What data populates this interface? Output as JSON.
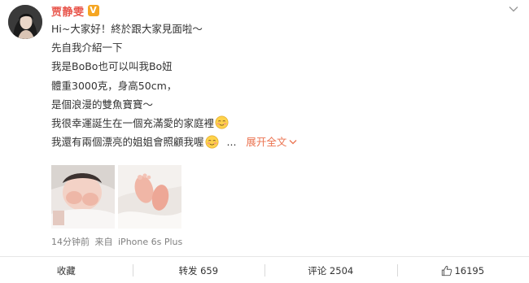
{
  "user": {
    "name": "贾静雯",
    "verified_badge": "V",
    "avatar": "avatar-photo"
  },
  "post": {
    "lines": [
      "Hi~大家好！終於跟大家見面啦～",
      "先自我介紹一下",
      "我是BoBo也可以叫我Bo妞",
      "體重3000克，身高50cm，",
      "是個浪漫的雙魚寶寶～",
      "我很幸運誕生在一個充滿愛的家庭裡",
      "我還有兩個漂亮的姐姐會照顧我喔"
    ],
    "ellipsis": "...",
    "expand_label": "展开全文",
    "photos": [
      "baby-face-photo",
      "baby-feet-photo"
    ]
  },
  "meta": {
    "time": "14分钟前",
    "source_prefix": "来自",
    "device": "iPhone 6s Plus"
  },
  "actions": {
    "favorite": "收藏",
    "repost": "转发 659",
    "comment": "评论 2504",
    "like": "16195"
  },
  "colors": {
    "username": "#e8544a",
    "link": "#eb7350",
    "badge": "#f5a623",
    "meta": "#808080"
  },
  "icons": {
    "menu": "chevron-down-icon",
    "emoji": "blush-smile-emoji",
    "like": "thumbs-up-icon"
  }
}
